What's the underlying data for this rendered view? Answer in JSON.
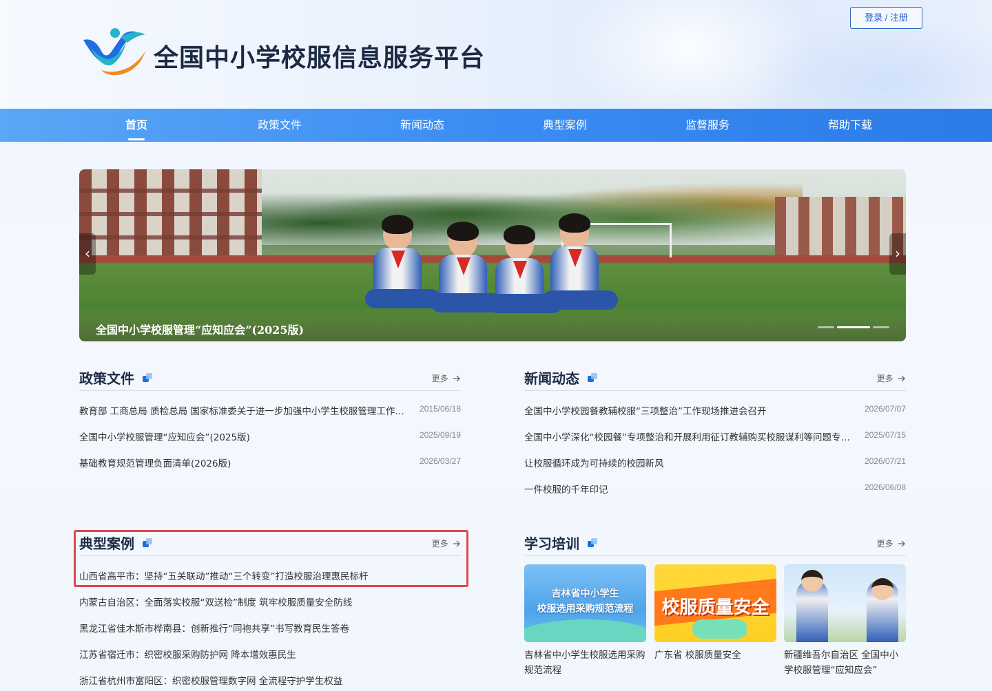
{
  "header": {
    "site_title": "全国中小学校服信息服务平台",
    "login_label": "登录 / 注册"
  },
  "nav": {
    "items": [
      {
        "label": "首页",
        "active": true
      },
      {
        "label": "政策文件"
      },
      {
        "label": "新闻动态"
      },
      {
        "label": "典型案例"
      },
      {
        "label": "监督服务"
      },
      {
        "label": "帮助下载"
      }
    ]
  },
  "banner": {
    "caption": "全国中小学校服管理“应知应会”(2025版)",
    "prev_icon": "‹",
    "next_icon": "›",
    "slide_count": 3,
    "active_slide": 2
  },
  "policy": {
    "title": "政策文件",
    "more": "更多",
    "items": [
      {
        "title": "教育部 工商总局 质检总局 国家标准委关于进一步加强中小学生校服管理工作的意见",
        "date": "2015/06/18"
      },
      {
        "title": "全国中小学校服管理“应知应会”(2025版)",
        "date": "2025/09/19"
      },
      {
        "title": "基础教育规范管理负面清单(2026版)",
        "date": "2026/03/27"
      }
    ]
  },
  "news": {
    "title": "新闻动态",
    "more": "更多",
    "items": [
      {
        "title": "全国中小学校园餐教辅校服“三项整治”工作现场推进会召开",
        "date": "2026/07/07"
      },
      {
        "title": "全国中小学深化“校园餐”专项整治和开展利用征订教辅购买校服谋利等问题专项整治",
        "date": "2025/07/15"
      },
      {
        "title": "让校服循环成为可持续的校园新风",
        "date": "2026/07/21"
      },
      {
        "title": "一件校服的千年印记",
        "date": "2026/06/08"
      }
    ]
  },
  "cases": {
    "title": "典型案例",
    "more": "更多",
    "items": [
      {
        "title": "山西省高平市：坚持“五关联动”推动“三个转变”打造校服治理惠民标杆"
      },
      {
        "title": "内蒙古自治区：全面落实校服“双送检”制度 筑牢校服质量安全防线"
      },
      {
        "title": "黑龙江省佳木斯市桦南县：创新推行“同袍共享”书写教育民生答卷"
      },
      {
        "title": "江苏省宿迁市：织密校服采购防护网 降本增效惠民生"
      },
      {
        "title": "浙江省杭州市富阳区：织密校服管理数字网 全流程守护学生权益"
      }
    ]
  },
  "training": {
    "title": "学习培训",
    "more": "更多",
    "cards": [
      {
        "thumb_text": "吉林省中小学生\n校服选用采购规范流程",
        "caption": "吉林省中小学生校服选用采购规范流程"
      },
      {
        "thumb_text": "校服质量安全",
        "caption": "广东省 校服质量安全"
      },
      {
        "thumb_text": "",
        "caption": "新疆维吾尔自治区 全国中小学校服管理“应知应会”"
      }
    ]
  },
  "colors": {
    "nav_start": "#5aa6f7",
    "nav_end": "#2b7be9",
    "title": "#1d2b46",
    "accent": "#1f6ddf",
    "highlight": "#e0454f"
  }
}
